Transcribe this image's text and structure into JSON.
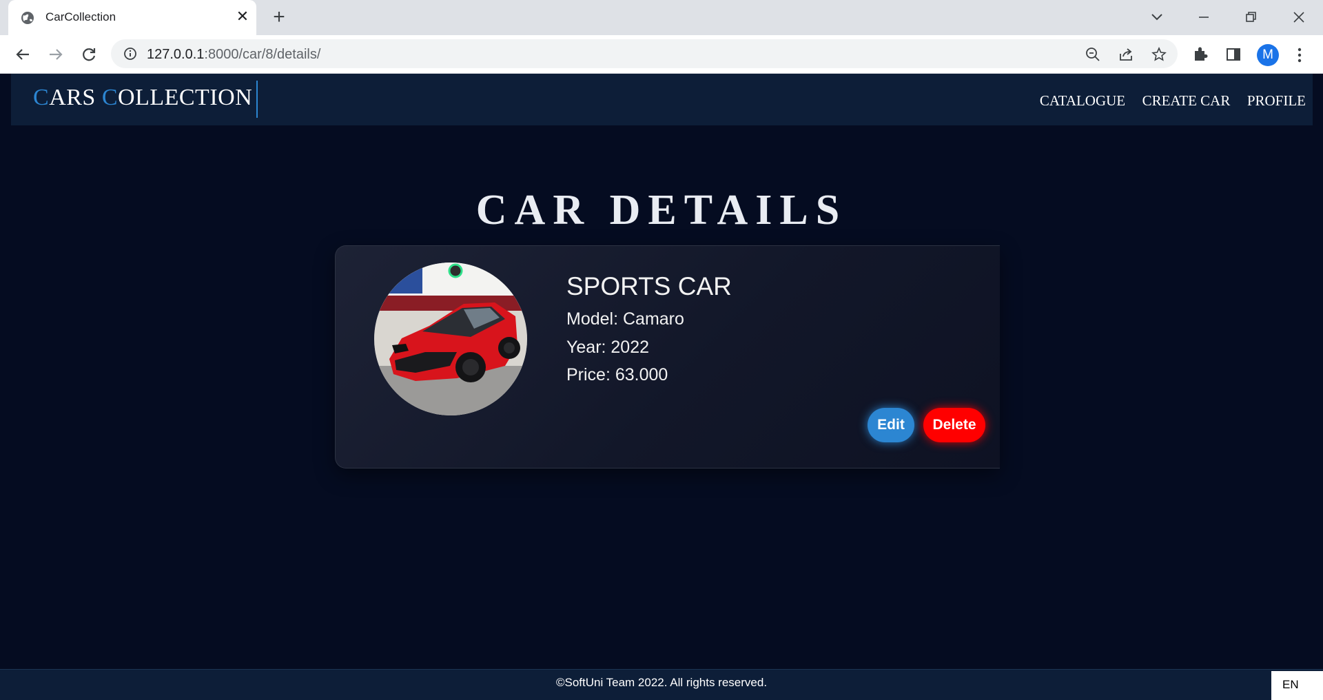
{
  "browser": {
    "tab_title": "CarCollection",
    "url_host": "127.0.0.1",
    "url_path": ":8000/car/8/details/",
    "profile_initial": "M",
    "icons": [
      "globe-icon",
      "close-icon",
      "plus-icon",
      "chevron-down-icon",
      "minimize-icon",
      "restore-icon",
      "close-window-icon",
      "back-icon",
      "forward-icon",
      "reload-icon",
      "info-icon",
      "zoom-out-icon",
      "share-icon",
      "star-icon",
      "puzzle-icon",
      "sidebar-icon",
      "kebab-menu-icon"
    ]
  },
  "site": {
    "logo_first_letter_1": "C",
    "logo_rest_1": "ARS ",
    "logo_first_letter_2": "C",
    "logo_rest_2": "OLLECTION",
    "nav": {
      "catalogue": "CATALOGUE",
      "create_car": "CREATE CAR",
      "profile": "PROFILE"
    },
    "accent_color": "#2c86d2",
    "background_color": "#050c21",
    "header_color": "#0d1e38"
  },
  "page": {
    "title": "CAR DETAILS"
  },
  "car": {
    "type": "SPORTS CAR",
    "model_label": "Model: Camaro",
    "year_label": "Year: 2022",
    "price_label": "Price: 63.000",
    "image_desc_icon": "car-photo"
  },
  "actions": {
    "edit": "Edit",
    "delete": "Delete",
    "edit_color": "#2c86d2",
    "delete_color": "#ff0000"
  },
  "footer": {
    "copyright": "©SoftUni Team 2022. All rights reserved.",
    "language": "EN"
  }
}
